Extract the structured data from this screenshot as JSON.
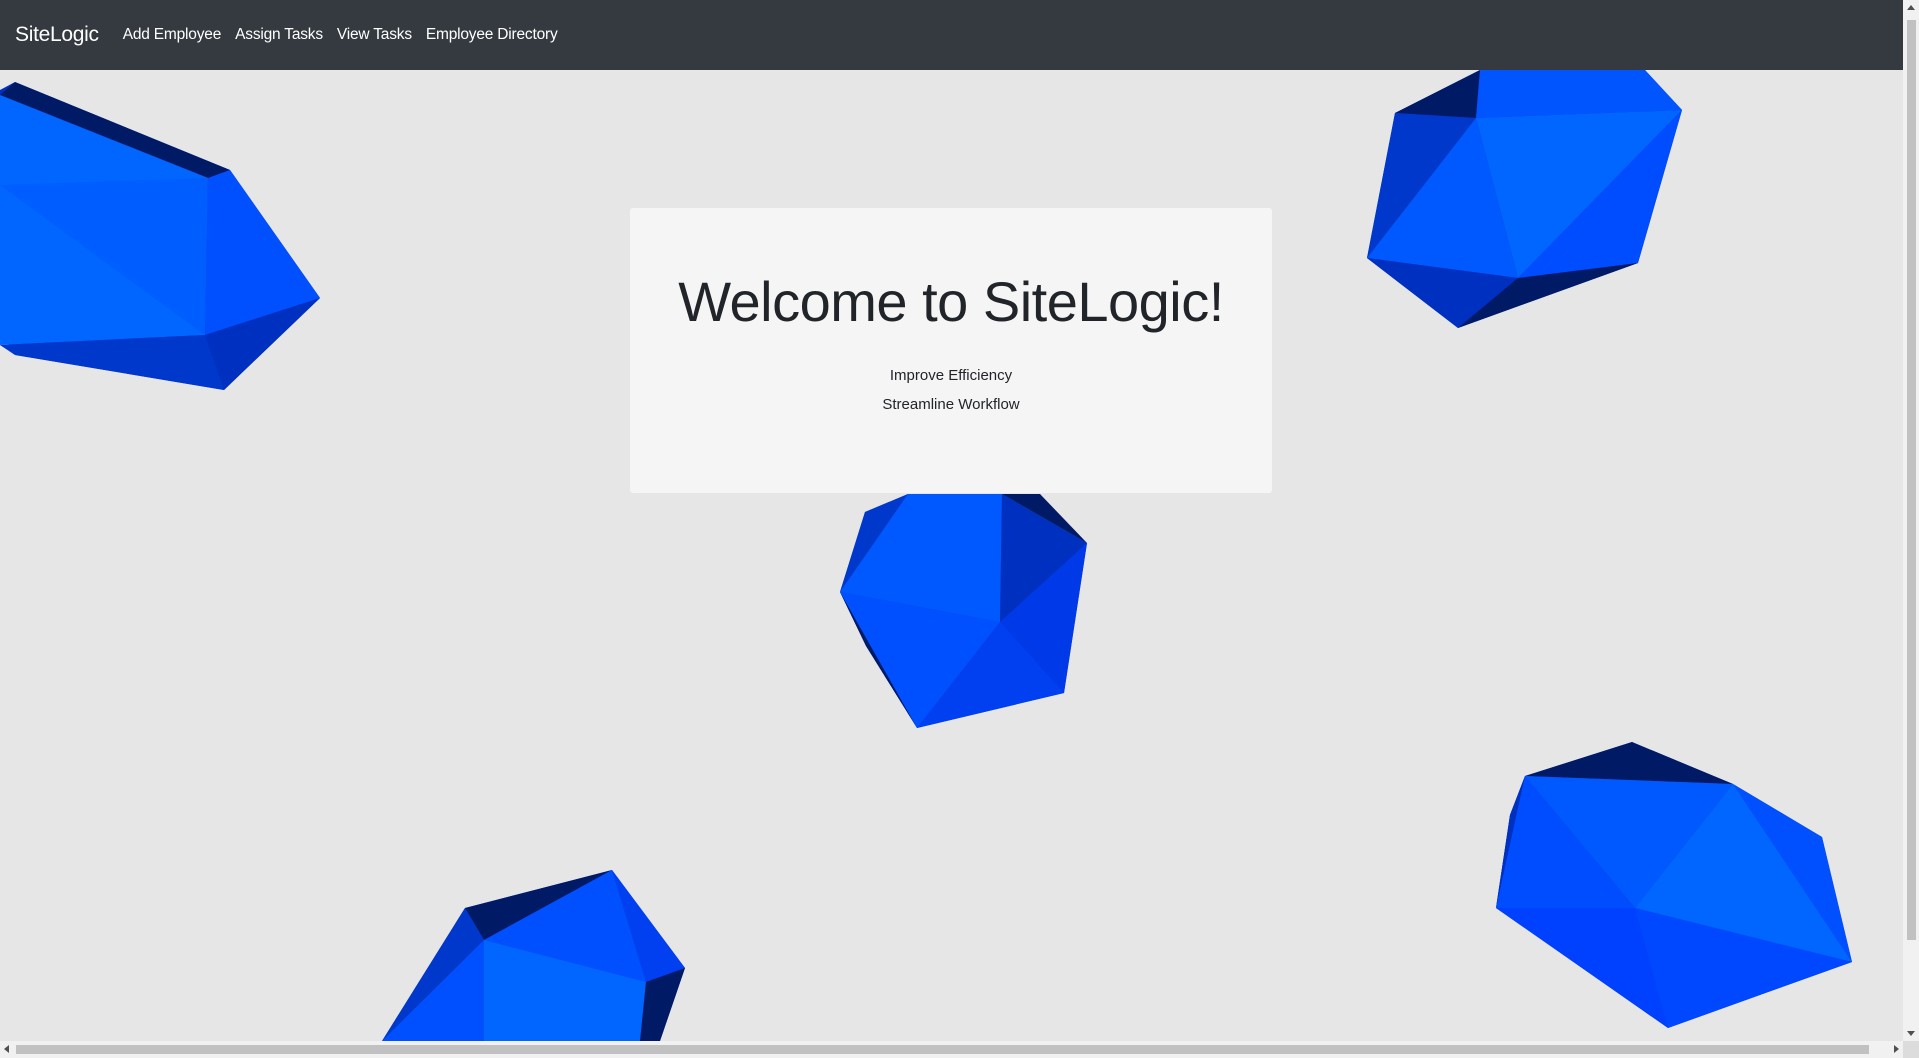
{
  "navbar": {
    "brand": "SiteLogic",
    "links": [
      {
        "label": "Add Employee"
      },
      {
        "label": "Assign Tasks"
      },
      {
        "label": "View Tasks"
      },
      {
        "label": "Employee Directory"
      }
    ]
  },
  "hero": {
    "title": "Welcome to SiteLogic!",
    "lines": [
      "Improve Efficiency",
      "Streamline Workflow"
    ]
  },
  "colors": {
    "navbar_bg": "#343a40",
    "page_bg": "#e6e6e6",
    "card_bg": "#f5f5f5",
    "gem_light": "#0066ff",
    "gem_mid": "#0050ff",
    "gem_dark": "#0030c0",
    "gem_darkest": "#001a66"
  },
  "decorations": {
    "gem_icon": "blue-polyhedron-icon",
    "count": 5
  }
}
